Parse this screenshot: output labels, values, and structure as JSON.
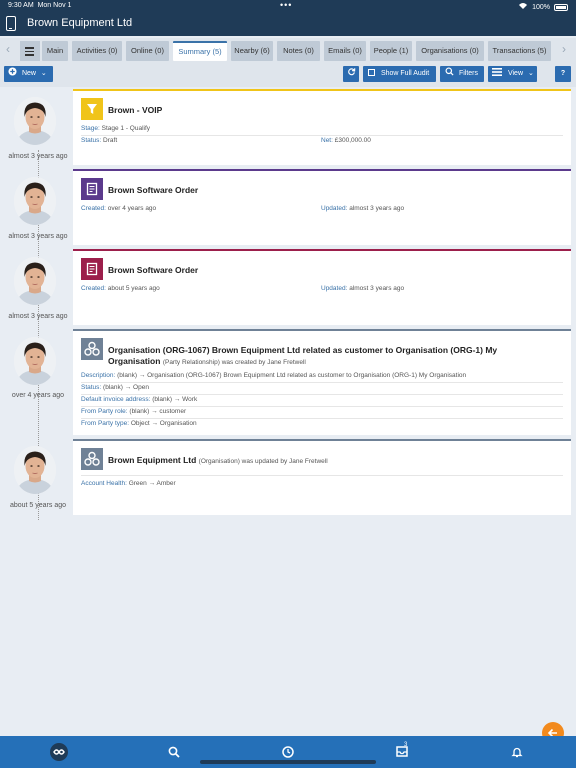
{
  "status_bar": {
    "time": "9:30 AM",
    "date": "Mon Nov 1",
    "dots": "•••",
    "battery": "100%"
  },
  "header": {
    "title": "Brown Equipment Ltd"
  },
  "tabs": [
    {
      "label": "Main"
    },
    {
      "label": "Activities (0)"
    },
    {
      "label": "Online (0)"
    },
    {
      "label": "Summary (5)"
    },
    {
      "label": "Nearby (6)"
    },
    {
      "label": "Notes (0)"
    },
    {
      "label": "Emails (0)"
    },
    {
      "label": "People (1)"
    },
    {
      "label": "Organisations (0)"
    },
    {
      "label": "Transactions (5)"
    }
  ],
  "active_tab": "Summary (5)",
  "toolbar": {
    "new_label": "New",
    "show_full_audit_label": "Show Full Audit",
    "filters_label": "Filters",
    "view_label": "View"
  },
  "timeline": [
    {
      "ago": "almost 3 years ago"
    },
    {
      "ago": "almost 3 years ago"
    },
    {
      "ago": "almost 3 years ago"
    },
    {
      "ago": "over 4 years ago"
    },
    {
      "ago": "about 5 years ago"
    }
  ],
  "cards": [
    {
      "icon": "funnel-icon",
      "icon_color": "#f0c419",
      "title": "Brown - VOIP",
      "stage_label": "Stage:",
      "stage_value": "Stage 1 - Qualify",
      "status_label": "Status:",
      "status_value": "Draft",
      "net_label": "Net:",
      "net_value": "£300,000.00"
    },
    {
      "icon": "order-icon",
      "icon_color": "#5b3a8c",
      "title": "Brown Software Order",
      "created_label": "Created:",
      "created_value": "over 4 years ago",
      "updated_label": "Updated:",
      "updated_value": "almost 3 years ago"
    },
    {
      "icon": "order-icon",
      "icon_color": "#9c1f4b",
      "title": "Brown Software Order",
      "created_label": "Created:",
      "created_value": "about 5 years ago",
      "updated_label": "Updated:",
      "updated_value": "almost 3 years ago"
    },
    {
      "icon": "organisation-icon",
      "icon_color": "#6f8196",
      "title_line1": "Organisation (ORG-1067) Brown Equipment Ltd related as customer to Organisation (ORG-1) My",
      "title_line2": "Organisation",
      "subtitle": "(Party Relationship) was created by Jane Fretwell",
      "rows": [
        {
          "label": "Description:",
          "value": "(blank) → Organisation (ORG-1067) Brown Equipment Ltd related as customer to Organisation (ORG-1) My Organisation"
        },
        {
          "label": "Status:",
          "value": "(blank) → Open"
        },
        {
          "label": "Default invoice address:",
          "value": "(blank) → Work"
        },
        {
          "label": "From Party role:",
          "value": "(blank) → customer"
        },
        {
          "label": "From Party type:",
          "value": "Object → Organisation"
        }
      ]
    },
    {
      "icon": "organisation-icon",
      "icon_color": "#6f8196",
      "title": "Brown Equipment Ltd",
      "subtitle": "(Organisation) was updated by Jane Fretwell",
      "rows": [
        {
          "label": "Account Health:",
          "value": "Green → Amber"
        }
      ]
    }
  ],
  "bottom_nav": {
    "notifications_badge": "3"
  },
  "colors": {
    "accent": "#2b6bb0",
    "header_bg": "#1f3b57",
    "bottom_bar": "#2570b8",
    "fab": "#f28a1d"
  }
}
